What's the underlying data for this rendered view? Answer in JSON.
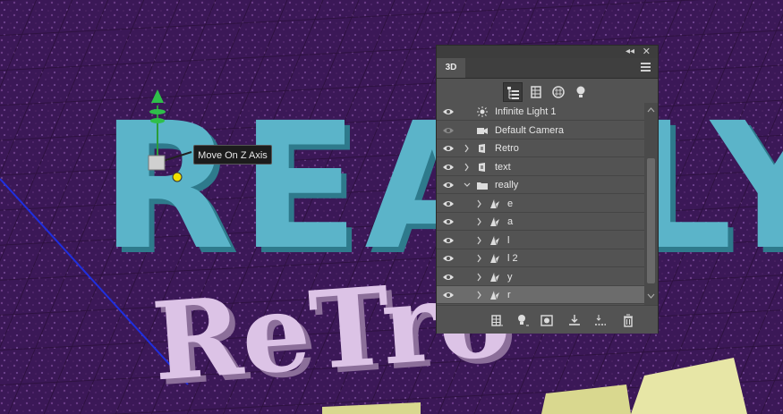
{
  "tooltip": {
    "text": "Move On Z Axis"
  },
  "panel": {
    "tab_label": "3D",
    "collapse_glyph": "◂◂",
    "close_glyph": "✕",
    "filters": [
      {
        "icon": "whole-scene-icon",
        "selected": true
      },
      {
        "icon": "meshes-icon",
        "selected": false
      },
      {
        "icon": "materials-icon",
        "selected": false
      },
      {
        "icon": "lights-icon",
        "selected": false
      }
    ],
    "layers": [
      {
        "label": "Infinite Light 1",
        "icon": "infinite-light-icon",
        "eye_dim": false,
        "expander": false,
        "indent": 0
      },
      {
        "label": "Default Camera",
        "icon": "camera-icon",
        "eye_dim": true,
        "expander": false,
        "indent": 0
      },
      {
        "label": "Retro",
        "icon": "mesh-group-icon",
        "eye_dim": false,
        "expander": "collapsed",
        "indent": 0
      },
      {
        "label": "text",
        "icon": "mesh-group-icon",
        "eye_dim": false,
        "expander": "collapsed",
        "indent": 0
      },
      {
        "label": "really",
        "icon": "folder-icon",
        "eye_dim": false,
        "expander": "expanded",
        "indent": 0
      },
      {
        "label": "e",
        "icon": "mesh-icon",
        "eye_dim": false,
        "expander": "collapsed",
        "indent": 1
      },
      {
        "label": "a",
        "icon": "mesh-icon",
        "eye_dim": false,
        "expander": "collapsed",
        "indent": 1
      },
      {
        "label": "l",
        "icon": "mesh-icon",
        "eye_dim": false,
        "expander": "collapsed",
        "indent": 1
      },
      {
        "label": "l 2",
        "icon": "mesh-icon",
        "eye_dim": false,
        "expander": "collapsed",
        "indent": 1
      },
      {
        "label": "y",
        "icon": "mesh-icon",
        "eye_dim": false,
        "expander": "collapsed",
        "indent": 1
      },
      {
        "label": "r",
        "icon": "mesh-icon",
        "eye_dim": false,
        "expander": "collapsed",
        "indent": 1,
        "selected": true
      }
    ],
    "bottom_buttons": [
      {
        "name": "add-mesh-button",
        "icon": "mesh-add-icon"
      },
      {
        "name": "add-light-button",
        "icon": "light-add-icon"
      },
      {
        "name": "add-constraint-button",
        "icon": "constraint-icon"
      },
      {
        "name": "drop-to-plane-button",
        "icon": "drop-to-plane-icon"
      },
      {
        "name": "drop-selection-button",
        "icon": "drop-selection-icon"
      },
      {
        "name": "delete-button",
        "icon": "trash-icon"
      }
    ]
  },
  "scene": {
    "main_text": "REALLY",
    "secondary_text": "ReTro",
    "colors": {
      "main": "#5bb4c9",
      "secondary": "#dcc3e6",
      "floor": "#3f1a5c",
      "axis": "#1f2fe0",
      "accent": "#e7e6a6"
    }
  }
}
